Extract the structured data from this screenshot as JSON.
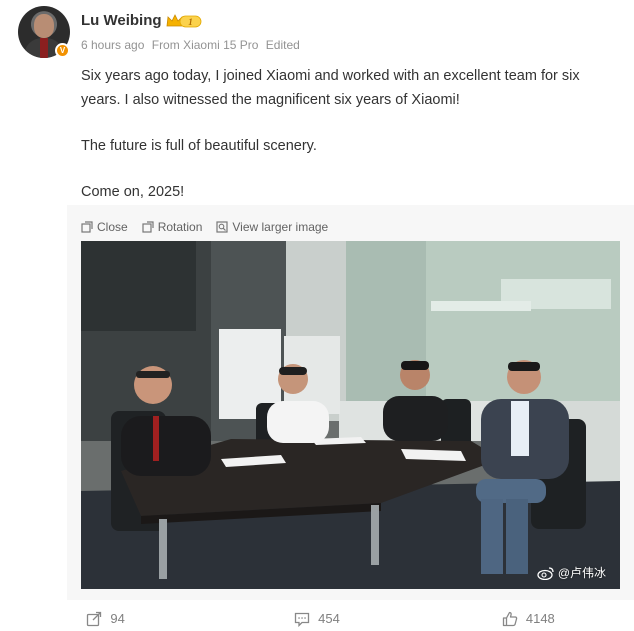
{
  "author": {
    "name": "Lu Weibing",
    "badge_level": "1",
    "verify_mark": "V"
  },
  "meta": {
    "time": "6 hours ago",
    "source": "From Xiaomi 15 Pro",
    "edited": "Edited"
  },
  "post": {
    "paragraph_1": "Six years ago today, I joined Xiaomi and worked with an excellent team for six years. I also witnessed the magnificent six years of Xiaomi!",
    "paragraph_2": "The future is full of beautiful scenery.",
    "paragraph_3": "Come on, 2025!"
  },
  "media_toolbar": {
    "close": "Close",
    "rotation": "Rotation",
    "view_larger": "View larger image"
  },
  "photo": {
    "watermark": "@卢伟冰"
  },
  "actions": {
    "repost_count": "94",
    "comment_count": "454",
    "like_count": "4148"
  },
  "colors": {
    "accent_orange": "#f29100",
    "meta_gray": "#939393",
    "badge_gold": "#f5b100"
  }
}
